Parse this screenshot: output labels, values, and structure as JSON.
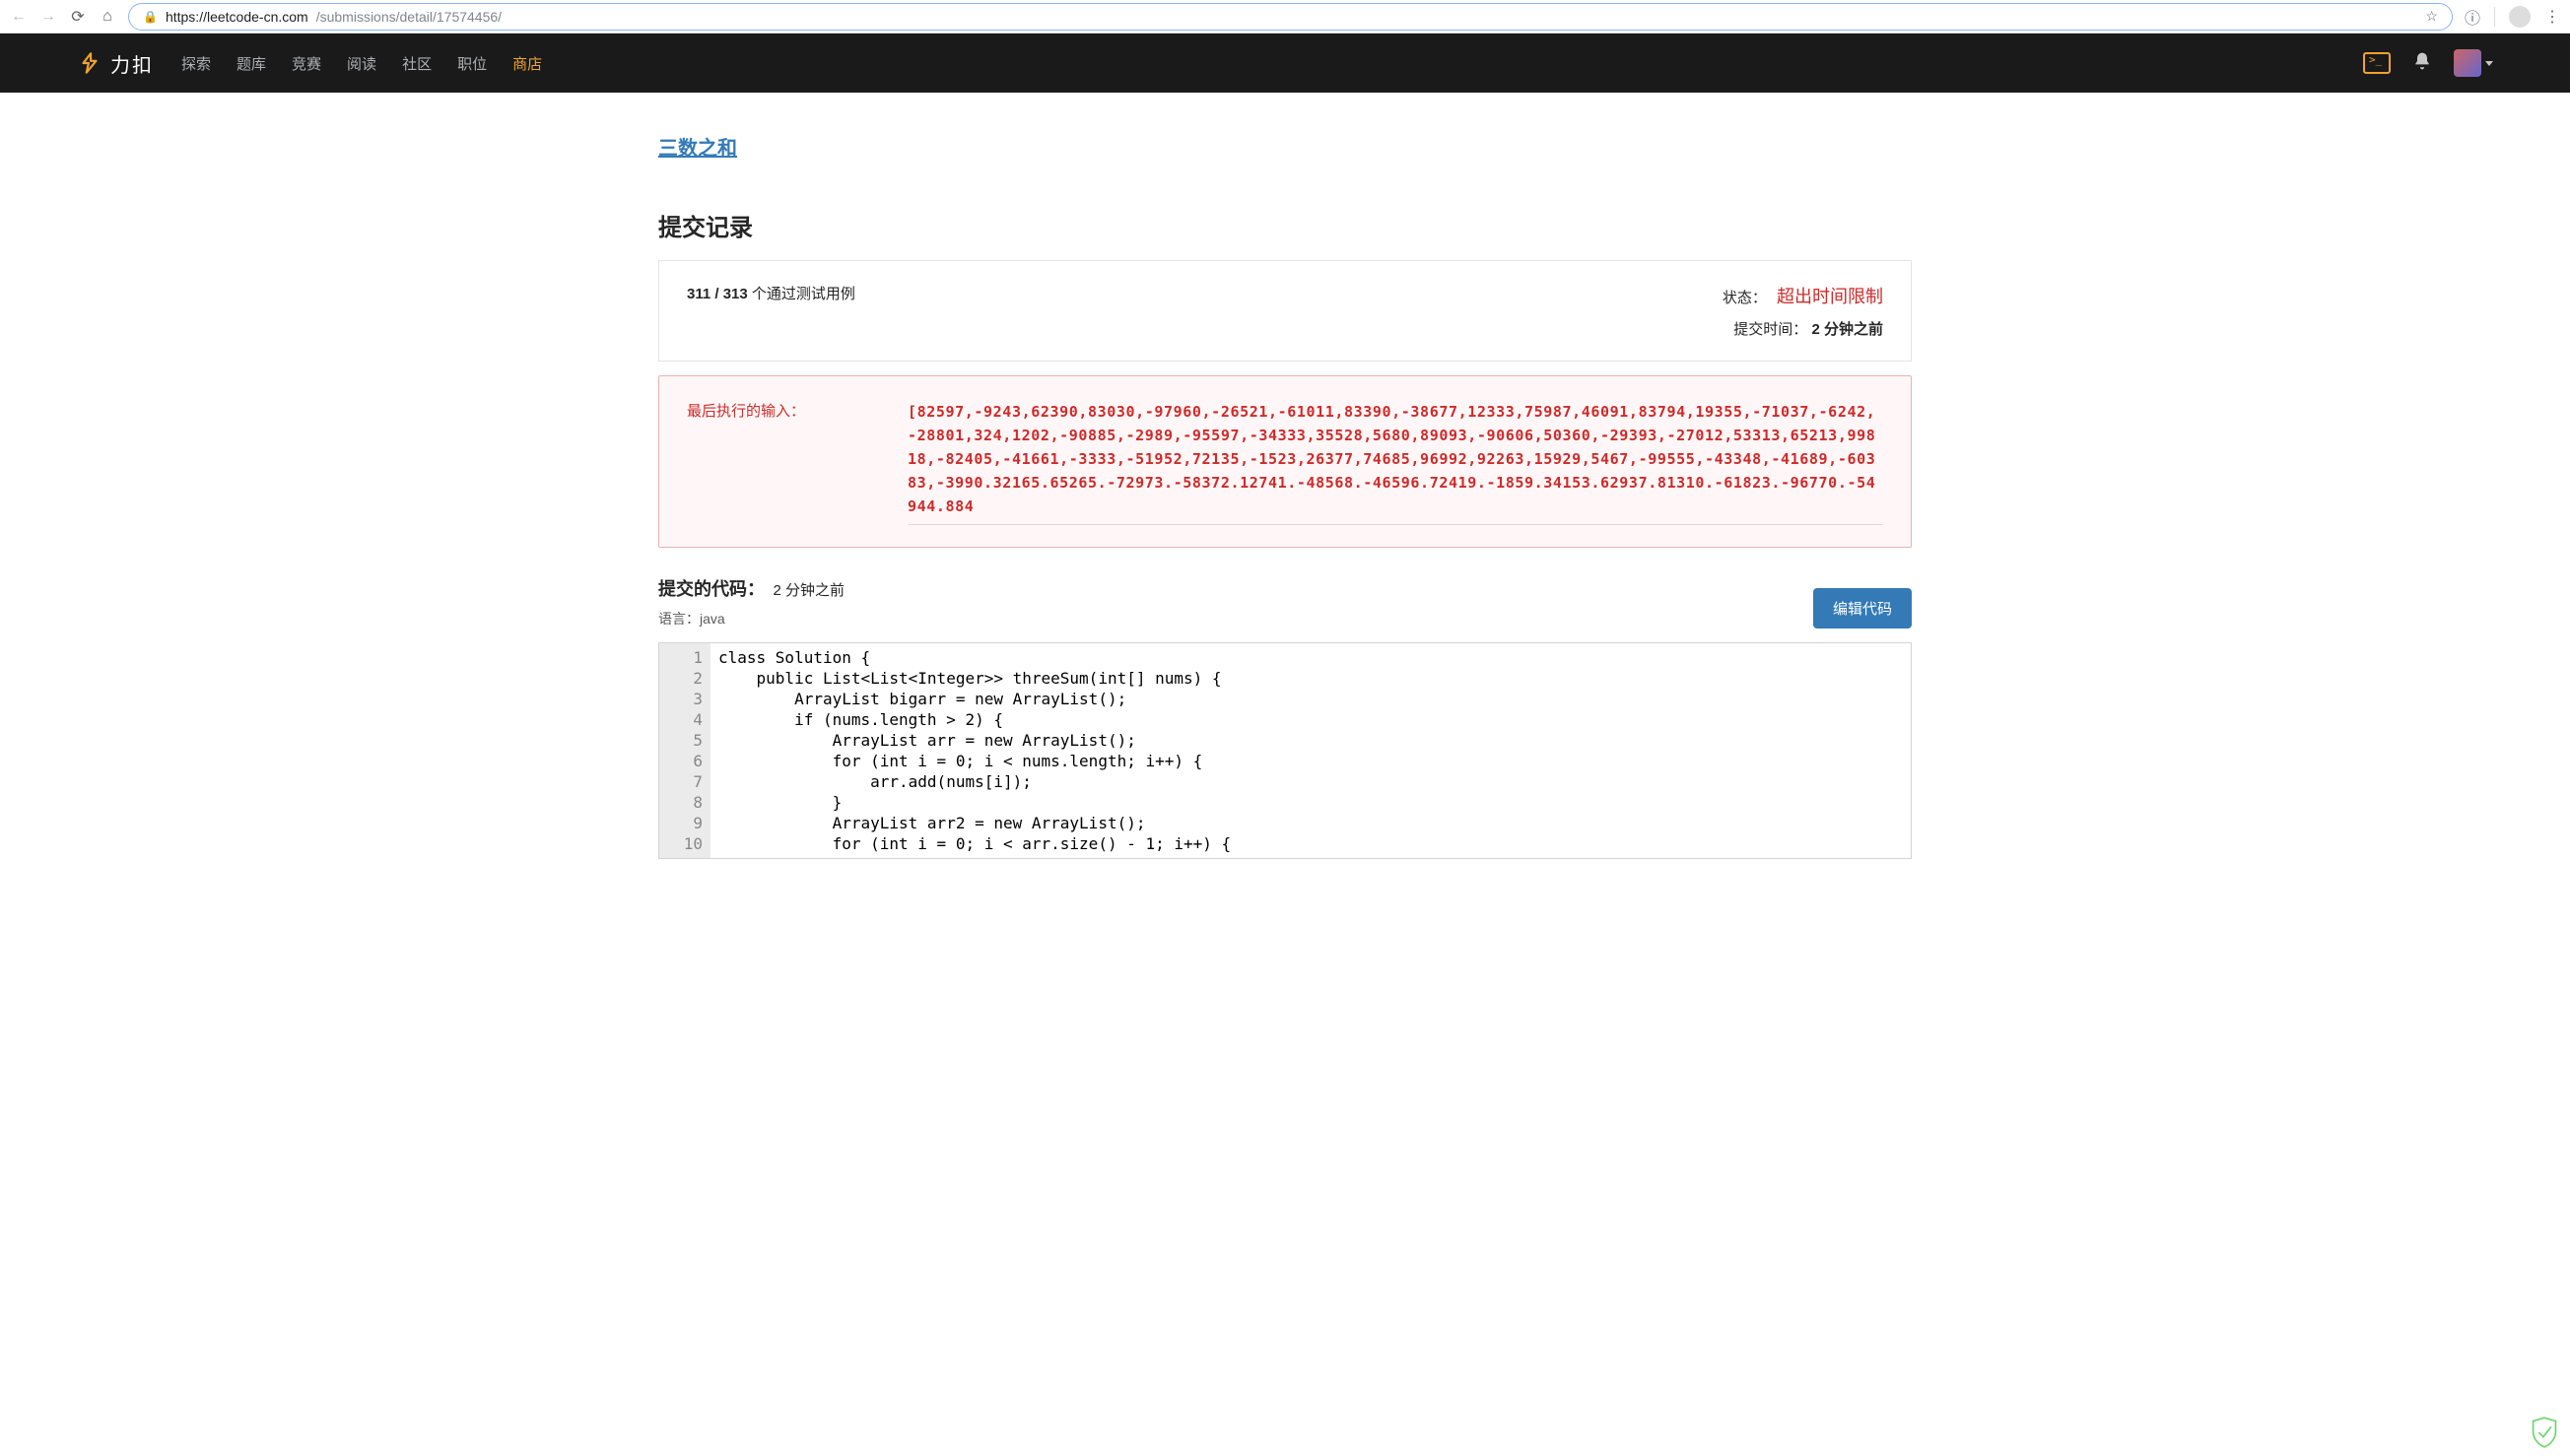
{
  "browser": {
    "url_host": "https://leetcode-cn.com",
    "url_path": "/submissions/detail/17574456/"
  },
  "brand": {
    "text": "力扣"
  },
  "nav": {
    "items": [
      "探索",
      "题库",
      "竞赛",
      "阅读",
      "社区",
      "职位",
      "商店"
    ],
    "accent_index": 6
  },
  "problem": {
    "title": "三数之和"
  },
  "section": {
    "record_title": "提交记录"
  },
  "result": {
    "passed": "311",
    "total": "313",
    "unit_label": " 个通过测试用例",
    "status_label": "状态：",
    "status_value": "超出时间限制",
    "submit_label": "提交时间：",
    "submit_value": "2 分钟之前"
  },
  "last_input": {
    "label": "最后执行的输入：",
    "value": "[82597,-9243,62390,83030,-97960,-26521,-61011,83390,-38677,12333,75987,46091,83794,19355,-71037,-6242,-28801,324,1202,-90885,-2989,-95597,-34333,35528,5680,89093,-90606,50360,-29393,-27012,53313,65213,99818,-82405,-41661,-3333,-51952,72135,-1523,26377,74685,96992,92263,15929,5467,-99555,-43348,-41689,-60383,-3990.32165.65265.-72973.-58372.12741.-48568.-46596.72419.-1859.34153.62937.81310.-61823.-96770.-54944.884"
  },
  "code_section": {
    "title": "提交的代码：",
    "time": "2 分钟之前",
    "lang_label": "语言：",
    "lang_value": "java",
    "edit_button": "编辑代码"
  },
  "code": {
    "lines": [
      "class Solution {",
      "    public List<List<Integer>> threeSum(int[] nums) {",
      "        ArrayList bigarr = new ArrayList();",
      "        if (nums.length > 2) {",
      "            ArrayList arr = new ArrayList();",
      "            for (int i = 0; i < nums.length; i++) {",
      "                arr.add(nums[i]);",
      "            }",
      "            ArrayList arr2 = new ArrayList();",
      "            for (int i = 0; i < arr.size() - 1; i++) {"
    ]
  }
}
